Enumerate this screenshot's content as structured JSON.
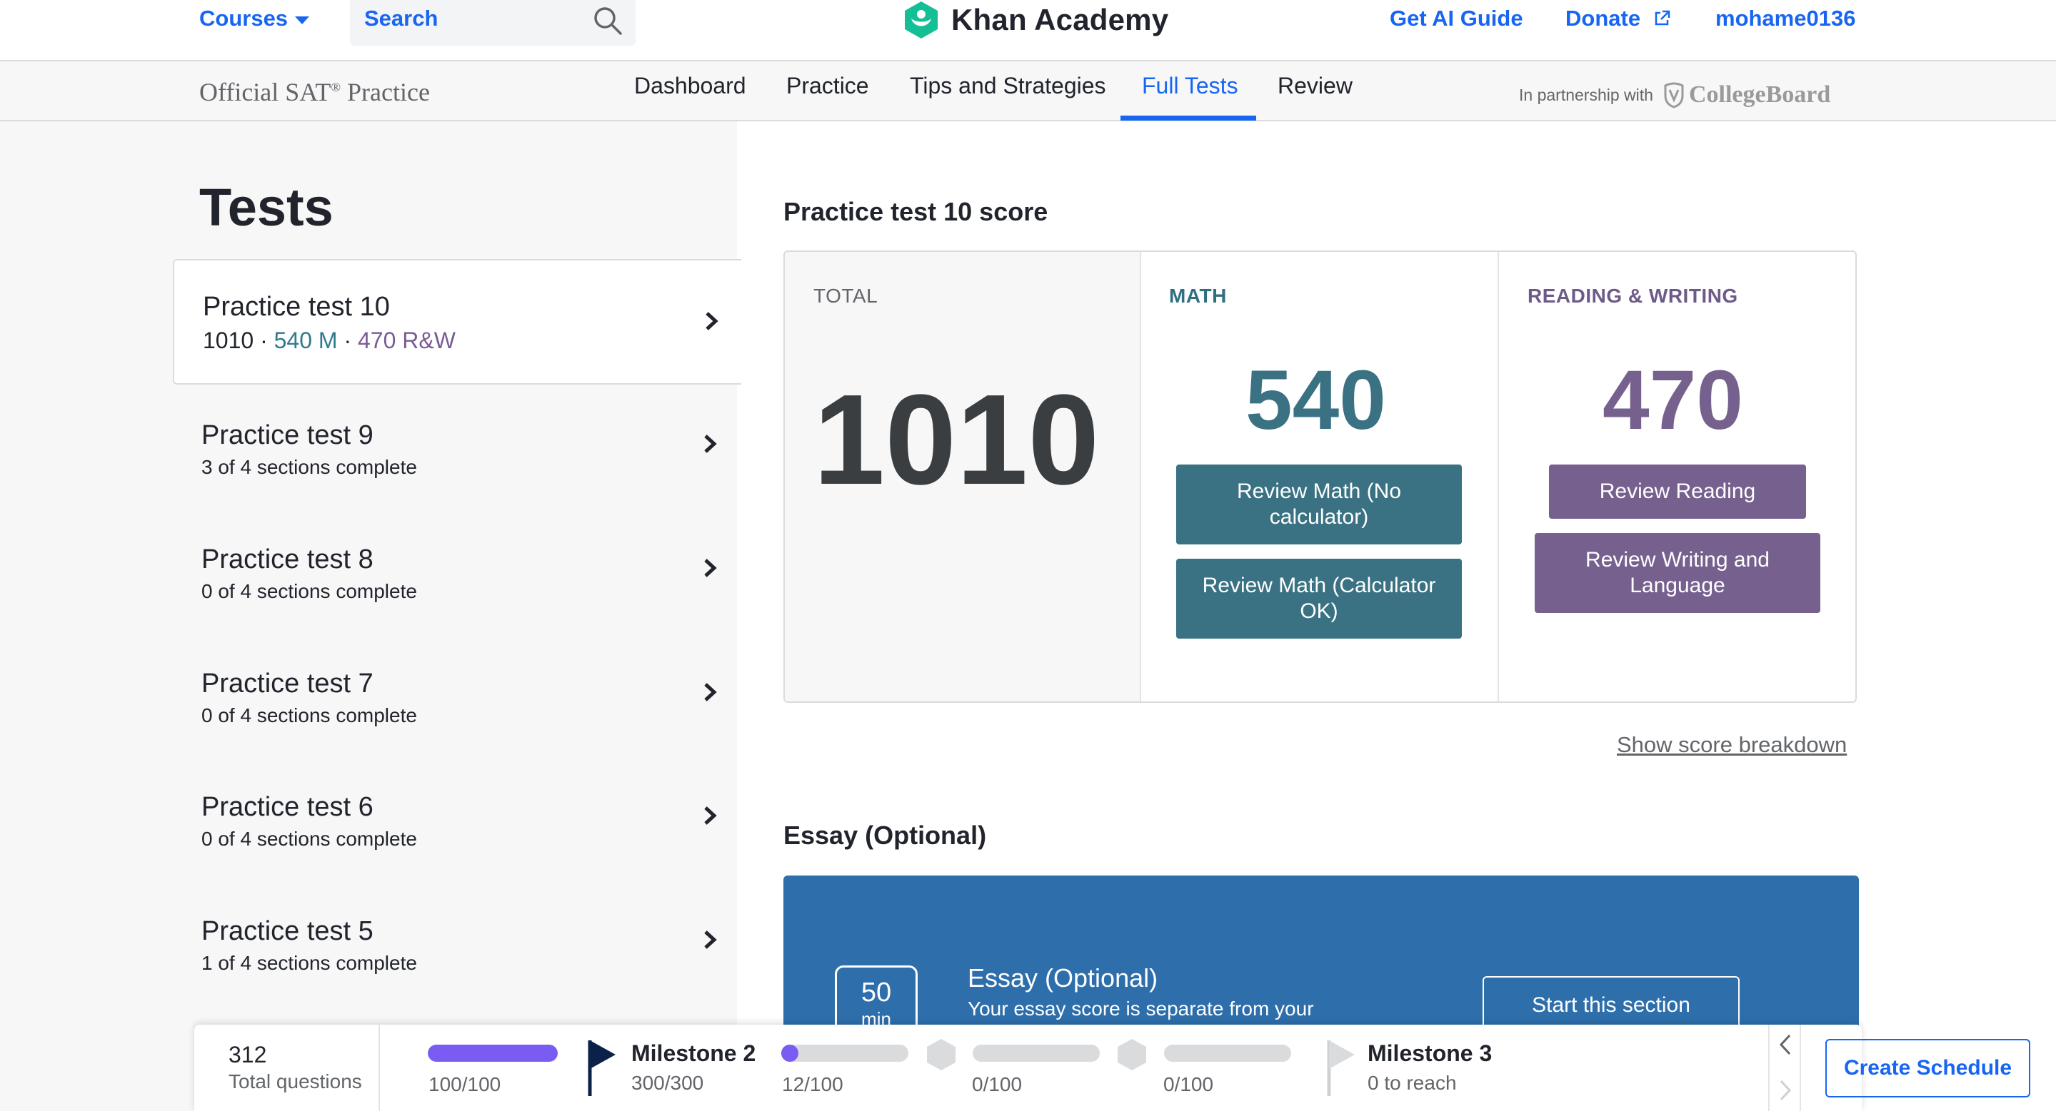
{
  "nav": {
    "courses_label": "Courses",
    "search_placeholder": "Search",
    "logo_text": "Khan Academy",
    "ai_guide_label": "Get AI Guide",
    "donate_label": "Donate",
    "username": "mohame0136"
  },
  "subnav": {
    "brand_name": "Official SAT",
    "brand_mark": "®",
    "brand_suffix": " Practice",
    "tabs": [
      "Dashboard",
      "Practice",
      "Tips and Strategies",
      "Full Tests",
      "Review"
    ],
    "active_tab": "Full Tests",
    "partner_text": "In partnership with",
    "partner_logo_text": "CollegeBoard"
  },
  "sidebar": {
    "title": "Tests",
    "tests": [
      {
        "name": "Practice test 10",
        "total": "1010",
        "sep": " · ",
        "math": "540 M",
        "rw": "470 R&W",
        "status": ""
      },
      {
        "name": "Practice test 9",
        "status": "3 of 4 sections complete"
      },
      {
        "name": "Practice test 8",
        "status": "0 of 4 sections complete"
      },
      {
        "name": "Practice test 7",
        "status": "0 of 4 sections complete"
      },
      {
        "name": "Practice test 6",
        "status": "0 of 4 sections complete"
      },
      {
        "name": "Practice test 5",
        "status": "1 of 4 sections complete"
      }
    ]
  },
  "score": {
    "title": "Practice test 10 score",
    "total_label": "TOTAL",
    "total_value": "1010",
    "math_label": "MATH",
    "math_value": "540",
    "rw_label": "READING & WRITING",
    "rw_value": "470",
    "btn_math_no_calc": "Review Math (No calculator)",
    "btn_math_calc": "Review Math (Calculator OK)",
    "btn_reading": "Review Reading",
    "btn_writing": "Review Writing and Language",
    "show_breakdown": "Show score breakdown",
    "colors": {
      "math": "#3a7283",
      "rw": "#76608e"
    }
  },
  "essay": {
    "section_title": "Essay (Optional)",
    "minutes": "50",
    "minutes_unit": "min",
    "title": "Essay (Optional)",
    "description": "Your essay score is separate from your",
    "start_label": "Start this section"
  },
  "progress": {
    "total_questions": "312",
    "total_questions_label": "Total questions",
    "segments": [
      {
        "value": "100/100",
        "fraction": 1.0
      },
      {
        "value": "12/100",
        "fraction": 0.12
      },
      {
        "value": "0/100",
        "fraction": 0.0
      },
      {
        "value": "0/100",
        "fraction": 0.0
      }
    ],
    "milestone2_title": "Milestone 2",
    "milestone2_value": "300/300",
    "milestone3_title": "Milestone 3",
    "milestone3_value": "0 to reach",
    "create_schedule_label": "Create Schedule",
    "accent_color": "#7b5cf3"
  }
}
